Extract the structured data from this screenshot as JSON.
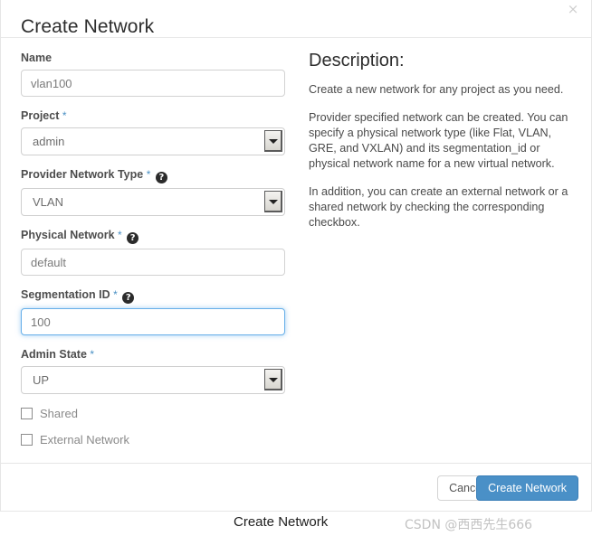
{
  "modal": {
    "title": "Create Network",
    "close_icon": "close-icon",
    "close_glyph": "×"
  },
  "form": {
    "fields": [
      {
        "label": "Name",
        "required": false,
        "help": false,
        "type": "text",
        "value": "vlan100",
        "focused": false
      },
      {
        "label": "Project",
        "required": true,
        "help": false,
        "type": "select",
        "value": "admin"
      },
      {
        "label": "Provider Network Type",
        "required": true,
        "help": true,
        "type": "select",
        "value": "VLAN"
      },
      {
        "label": "Physical Network",
        "required": true,
        "help": true,
        "type": "text",
        "value": "default",
        "focused": false
      },
      {
        "label": "Segmentation ID",
        "required": true,
        "help": true,
        "type": "text",
        "value": "100",
        "focused": true
      },
      {
        "label": "Admin State",
        "required": true,
        "help": false,
        "type": "select",
        "value": "UP"
      }
    ],
    "required_marker": "*",
    "help_glyph": "?",
    "checkboxes": [
      {
        "label": "Shared",
        "checked": false
      },
      {
        "label": "External Network",
        "checked": false
      }
    ]
  },
  "description": {
    "heading": "Description:",
    "paragraphs": [
      "Create a new network for any project as you need.",
      "Provider specified network can be created. You can specify a physical network type (like Flat, VLAN, GRE, and VXLAN) and its segmentation_id or physical network name for a new virtual network.",
      "In addition, you can create an external network or a shared network by checking the corresponding checkbox."
    ]
  },
  "footer": {
    "cancel_label": "Cancel",
    "submit_label": "Create Network"
  },
  "caption": {
    "text": "Create Network",
    "watermark": "CSDN @西西先生666"
  },
  "colors": {
    "accent": "#4a90c7",
    "focus_border": "#66afe9",
    "required_star": "#4a90c4",
    "label": "#4d4d4d"
  }
}
